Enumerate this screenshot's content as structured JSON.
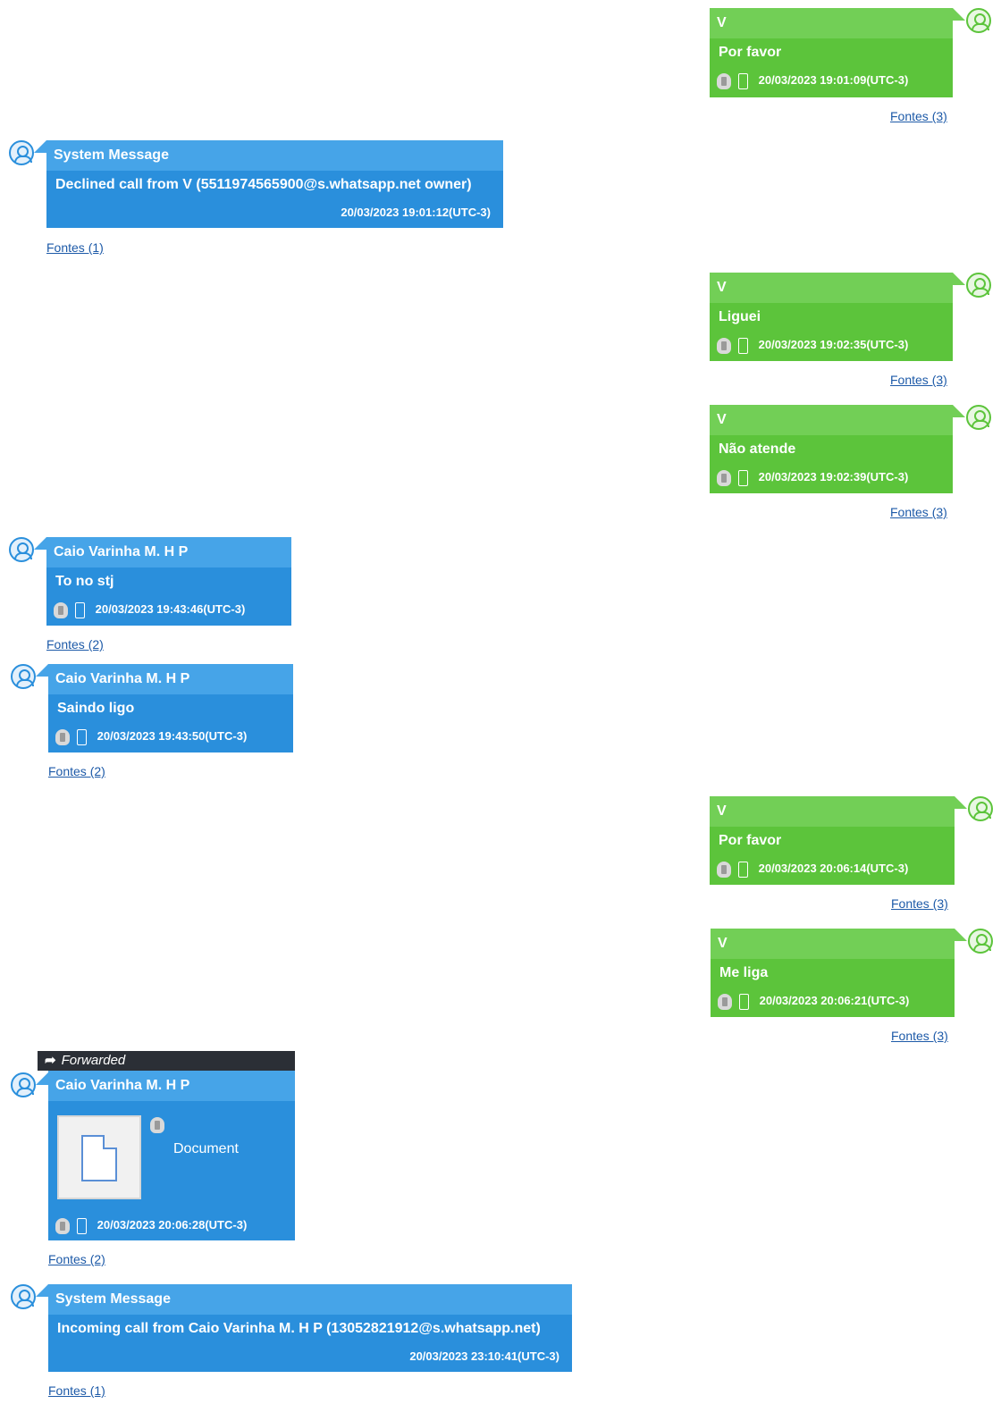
{
  "messages": [
    {
      "sender": "V",
      "text": "Por favor",
      "timestamp": "20/03/2023 19:01:09(UTC-3)",
      "sources": "Fontes (3)"
    },
    {
      "sender": "System Message",
      "text": "Declined call from V (5511974565900@s.whatsapp.net owner)",
      "timestamp": "20/03/2023 19:01:12(UTC-3)",
      "sources": "Fontes (1)"
    },
    {
      "sender": "V",
      "text": "Liguei",
      "timestamp": "20/03/2023 19:02:35(UTC-3)",
      "sources": "Fontes (3)"
    },
    {
      "sender": "V",
      "text": "Não atende",
      "timestamp": "20/03/2023 19:02:39(UTC-3)",
      "sources": "Fontes (3)"
    },
    {
      "sender": "Caio Varinha M. H P",
      "text": "To no stj",
      "timestamp": "20/03/2023 19:43:46(UTC-3)",
      "sources": "Fontes (2)"
    },
    {
      "sender": "Caio Varinha M. H P",
      "text": "Saindo ligo",
      "timestamp": "20/03/2023 19:43:50(UTC-3)",
      "sources": "Fontes (2)"
    },
    {
      "sender": "V",
      "text": "Por favor",
      "timestamp": "20/03/2023 20:06:14(UTC-3)",
      "sources": "Fontes (3)"
    },
    {
      "sender": "V",
      "text": "Me liga",
      "timestamp": "20/03/2023 20:06:21(UTC-3)",
      "sources": "Fontes (3)"
    },
    {
      "forwarded_label": "Forwarded",
      "sender": "Caio Varinha M. H P",
      "attachment_label": "Document",
      "timestamp": "20/03/2023 20:06:28(UTC-3)",
      "sources": "Fontes (2)"
    },
    {
      "sender": "System Message",
      "text": "Incoming call from Caio Varinha M. H P (13052821912@s.whatsapp.net)",
      "timestamp": "20/03/2023 23:10:41(UTC-3)",
      "sources": "Fontes (1)"
    }
  ],
  "colors": {
    "outgoing": "#5cc43b",
    "incoming": "#2a8fdc",
    "link": "#1d5aa8"
  },
  "icons": [
    "user-avatar-icon",
    "trash-icon",
    "phone-icon",
    "forward-arrow-icon",
    "document-icon"
  ]
}
